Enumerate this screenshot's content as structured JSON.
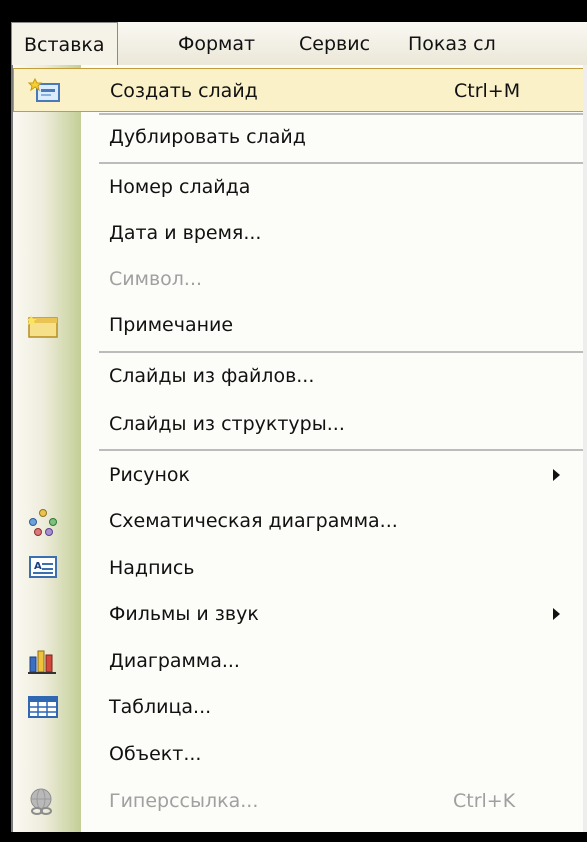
{
  "menubar": {
    "items": [
      {
        "label": "Вставка",
        "active": true
      },
      {
        "label": "Формат"
      },
      {
        "label": "Сервис"
      },
      {
        "label": "Показ сл"
      }
    ]
  },
  "menu": {
    "items": [
      {
        "label": "Создать слайд",
        "shortcut": "Ctrl+M",
        "icon": "new-slide-icon",
        "highlighted": true
      },
      {
        "label": "Дублировать слайд"
      },
      {
        "label": "Номер слайда"
      },
      {
        "label": "Дата и время..."
      },
      {
        "label": "Символ...",
        "disabled": true
      },
      {
        "label": "Примечание",
        "icon": "comment-icon"
      },
      {
        "label": "Слайды из файлов..."
      },
      {
        "label": "Слайды из структуры..."
      },
      {
        "label": "Рисунок",
        "submenu": true
      },
      {
        "label": "Схематическая диаграмма...",
        "icon": "diagram-icon"
      },
      {
        "label": "Надпись",
        "icon": "textbox-icon"
      },
      {
        "label": "Фильмы и звук",
        "submenu": true
      },
      {
        "label": "Диаграмма...",
        "icon": "chart-icon"
      },
      {
        "label": "Таблица...",
        "icon": "table-icon"
      },
      {
        "label": "Объект..."
      },
      {
        "label": "Гиперссылка...",
        "shortcut": "Ctrl+K",
        "icon": "hyperlink-icon",
        "disabled": true
      }
    ]
  },
  "colors": {
    "highlight": "#fbf1c8",
    "highlight_border": "#c19d3c",
    "disabled_text": "#a0a0a0",
    "gutter_green": "#c3cf96"
  }
}
